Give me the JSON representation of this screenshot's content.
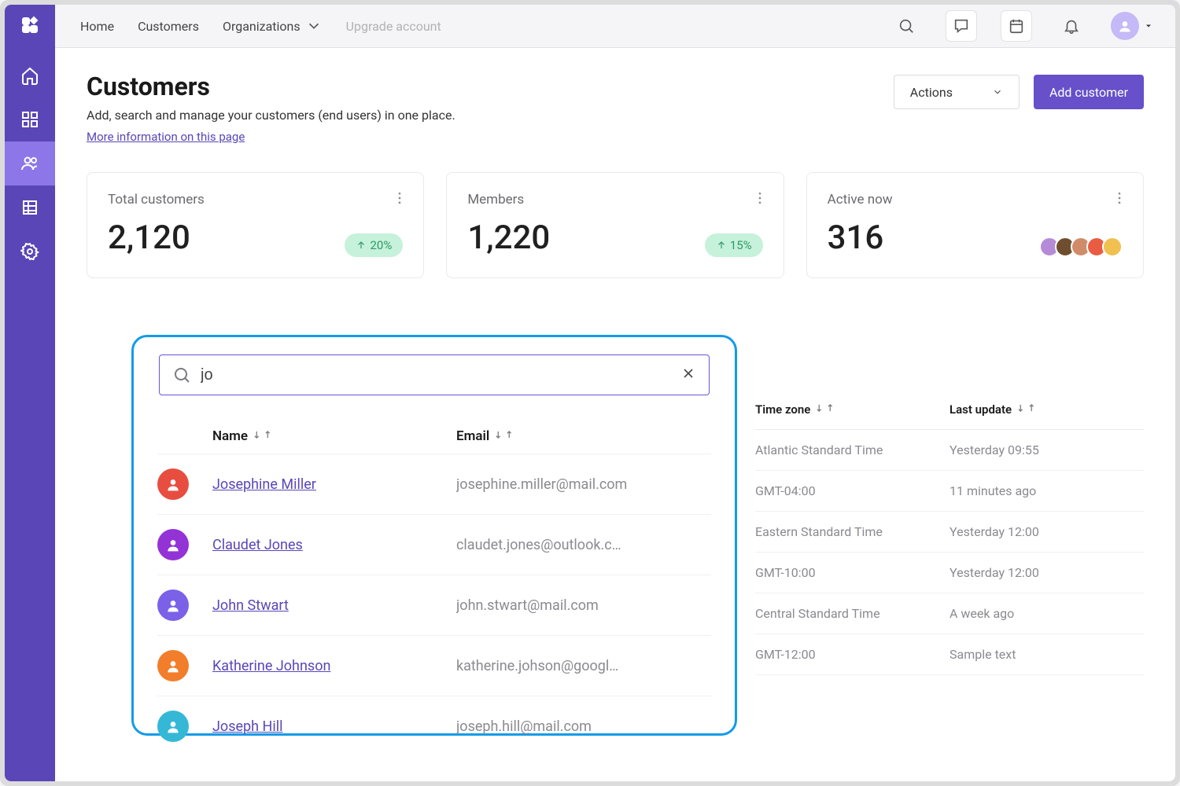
{
  "nav": {
    "home": "Home",
    "customers": "Customers",
    "organizations": "Organizations",
    "upgrade": "Upgrade account"
  },
  "page": {
    "title": "Customers",
    "subtitle": "Add, search and manage your customers (end users) in one place.",
    "more_link": "More information on this page",
    "actions_btn": "Actions",
    "add_btn": "Add customer"
  },
  "stats": {
    "total": {
      "label": "Total customers",
      "value": "2,120",
      "trend": "20%"
    },
    "members": {
      "label": "Members",
      "value": "1,220",
      "trend": "15%"
    },
    "active": {
      "label": "Active now",
      "value": "316"
    }
  },
  "active_avatars": [
    "#b58bd8",
    "#6e4e2e",
    "#d08c6a",
    "#e85c42",
    "#f0c050"
  ],
  "bg_cols": {
    "tz": "Time zone",
    "last": "Last update"
  },
  "bg_rows": [
    {
      "tz": "Atlantic Standard Time",
      "last": "Yesterday 09:55"
    },
    {
      "tz": "GMT-04:00",
      "last": "11 minutes ago"
    },
    {
      "tz": "Eastern Standard Time",
      "last": "Yesterday 12:00"
    },
    {
      "tz": "GMT-10:00",
      "last": "Yesterday 12:00"
    },
    {
      "tz": "Central Standard Time",
      "last": "A week ago"
    },
    {
      "tz": "GMT-12:00",
      "last": "Sample text"
    }
  ],
  "search": {
    "value": "jo"
  },
  "pop_cols": {
    "name": "Name",
    "email": "Email"
  },
  "pop_rows": [
    {
      "name": "Josephine Miller",
      "email": "josephine.miller@mail.com",
      "avatar_bg": "#E84E40"
    },
    {
      "name": "Claudet Jones",
      "email": "claudet.jones@outlook.c…",
      "avatar_bg": "#9333D6"
    },
    {
      "name": "John Stwart",
      "email": "john.stwart@mail.com",
      "avatar_bg": "#7B61E8"
    },
    {
      "name": "Katherine Johnson",
      "email": "katherine.johson@googl…",
      "avatar_bg": "#F27E2B"
    },
    {
      "name": "Joseph Hill",
      "email": "joseph.hill@mail.com",
      "avatar_bg": "#35B8D6"
    }
  ]
}
